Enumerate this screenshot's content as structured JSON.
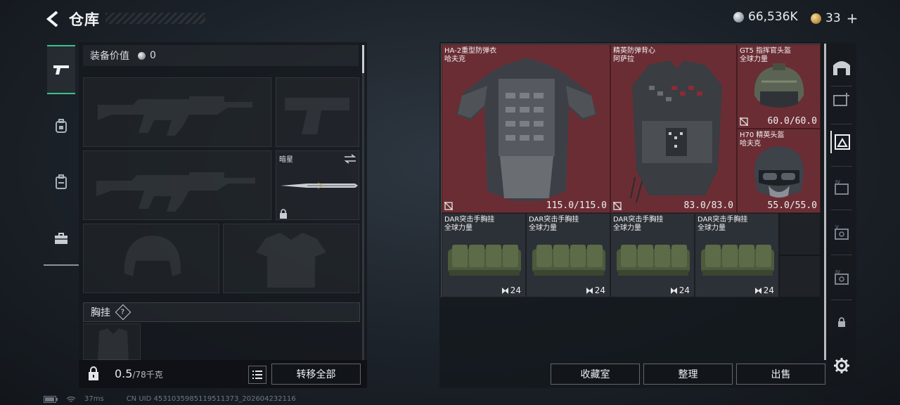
{
  "header": {
    "title": "仓库",
    "currency_coins": "66,536K",
    "currency_premium": "33"
  },
  "left": {
    "equip_value_label": "装备价值",
    "equip_value": "0",
    "knife_label": "暗星",
    "rig_label": "胸挂",
    "help_glyph": "?",
    "weight_current": "0.5",
    "weight_max": "/78千克",
    "transfer_all": "转移全部"
  },
  "items": {
    "armor1": {
      "name": "HA-2重型防弹衣",
      "faction": "哈夫克",
      "durability": "115.0/115.0"
    },
    "armor2": {
      "name": "精英防弹背心",
      "faction": "阿萨拉",
      "durability": "83.0/83.0"
    },
    "helmet1": {
      "name": "GT5 指挥官头盔",
      "faction": "全球力量",
      "durability": "60.0/60.0"
    },
    "helmet2": {
      "name": "H70 精英头盔",
      "faction": "哈夫克",
      "durability": "55.0/55.0"
    },
    "rigs": [
      {
        "name": "DAR突击手胸挂",
        "faction": "全球力量",
        "capacity": "24"
      },
      {
        "name": "DAR突击手胸挂",
        "faction": "全球力量",
        "capacity": "24"
      },
      {
        "name": "DAR突击手胸挂",
        "faction": "全球力量",
        "capacity": "24"
      },
      {
        "name": "DAR突击手胸挂",
        "faction": "全球力量",
        "capacity": "24"
      }
    ]
  },
  "actions": {
    "collection": "收藏室",
    "organize": "整理",
    "sell": "出售"
  },
  "status": {
    "ping": "37ms",
    "uid": "CN UID 4531035985119511373_202604232116"
  },
  "icons": {
    "back": "chevron-left-icon",
    "coin": "silver-coin-icon",
    "premium": "gold-coin-icon",
    "settings": "gear-icon"
  }
}
